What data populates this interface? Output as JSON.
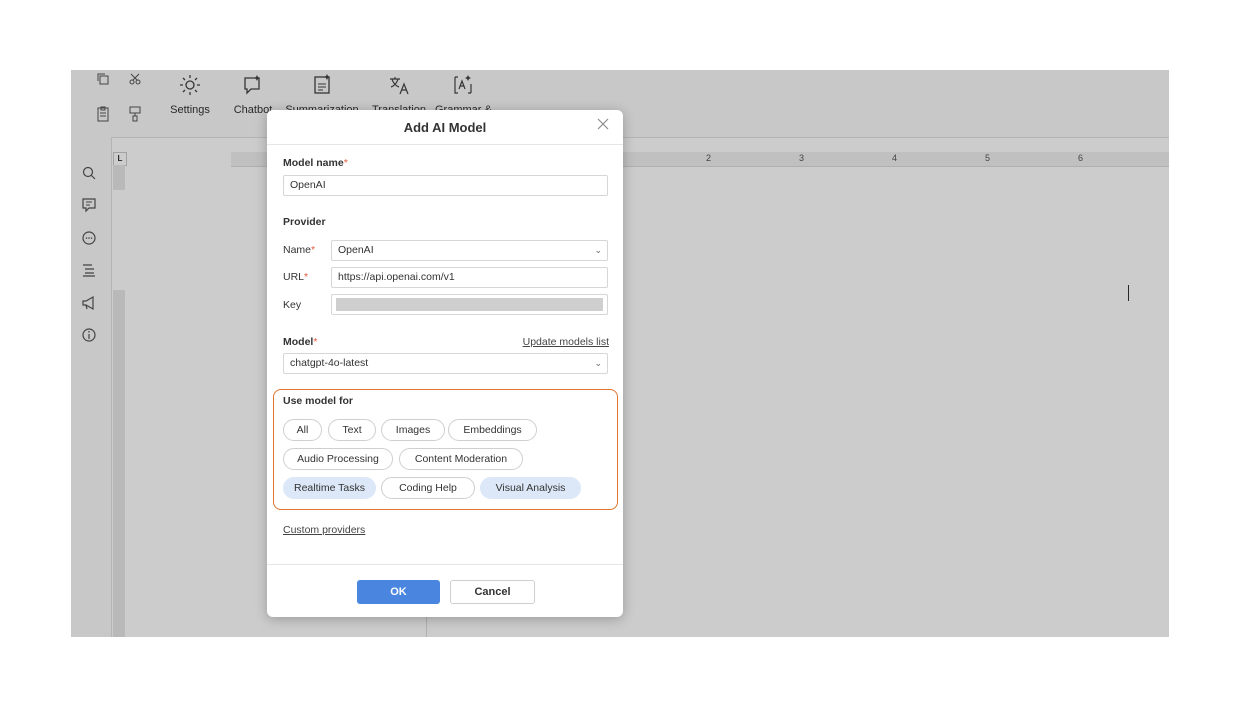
{
  "toolbar": {
    "settings_label": "Settings",
    "chatbot_label": "Chatbot",
    "summarization_label": "Summarization",
    "translation_label": "Translation",
    "grammar_label": "Grammar &"
  },
  "ruler": {
    "numbers": [
      "2",
      "3",
      "4",
      "5",
      "6"
    ],
    "tab_marker": "L"
  },
  "dialog": {
    "title": "Add AI Model",
    "model_name_label": "Model name",
    "model_name_value": "OpenAI",
    "provider_label": "Provider",
    "provider_name_label": "Name",
    "provider_name_value": "OpenAI",
    "url_label": "URL",
    "url_value": "https://api.openai.com/v1",
    "key_label": "Key",
    "model_label": "Model",
    "update_models_link": "Update models list",
    "model_value": "chatgpt-4o-latest",
    "use_model_for_label": "Use model for",
    "chips": [
      {
        "label": "All",
        "selected": false
      },
      {
        "label": "Text",
        "selected": false
      },
      {
        "label": "Images",
        "selected": false
      },
      {
        "label": "Embeddings",
        "selected": false
      },
      {
        "label": "Audio Processing",
        "selected": false
      },
      {
        "label": "Content Moderation",
        "selected": false
      },
      {
        "label": "Realtime Tasks",
        "selected": true
      },
      {
        "label": "Coding Help",
        "selected": false
      },
      {
        "label": "Visual Analysis",
        "selected": true
      }
    ],
    "custom_providers_link": "Custom providers",
    "ok_label": "OK",
    "cancel_label": "Cancel",
    "required_mark": "*"
  },
  "colors": {
    "accent": "#4a86e0",
    "highlight_border": "#e0762f",
    "selected_chip": "#dce7f7",
    "required": "#e05a3a"
  }
}
